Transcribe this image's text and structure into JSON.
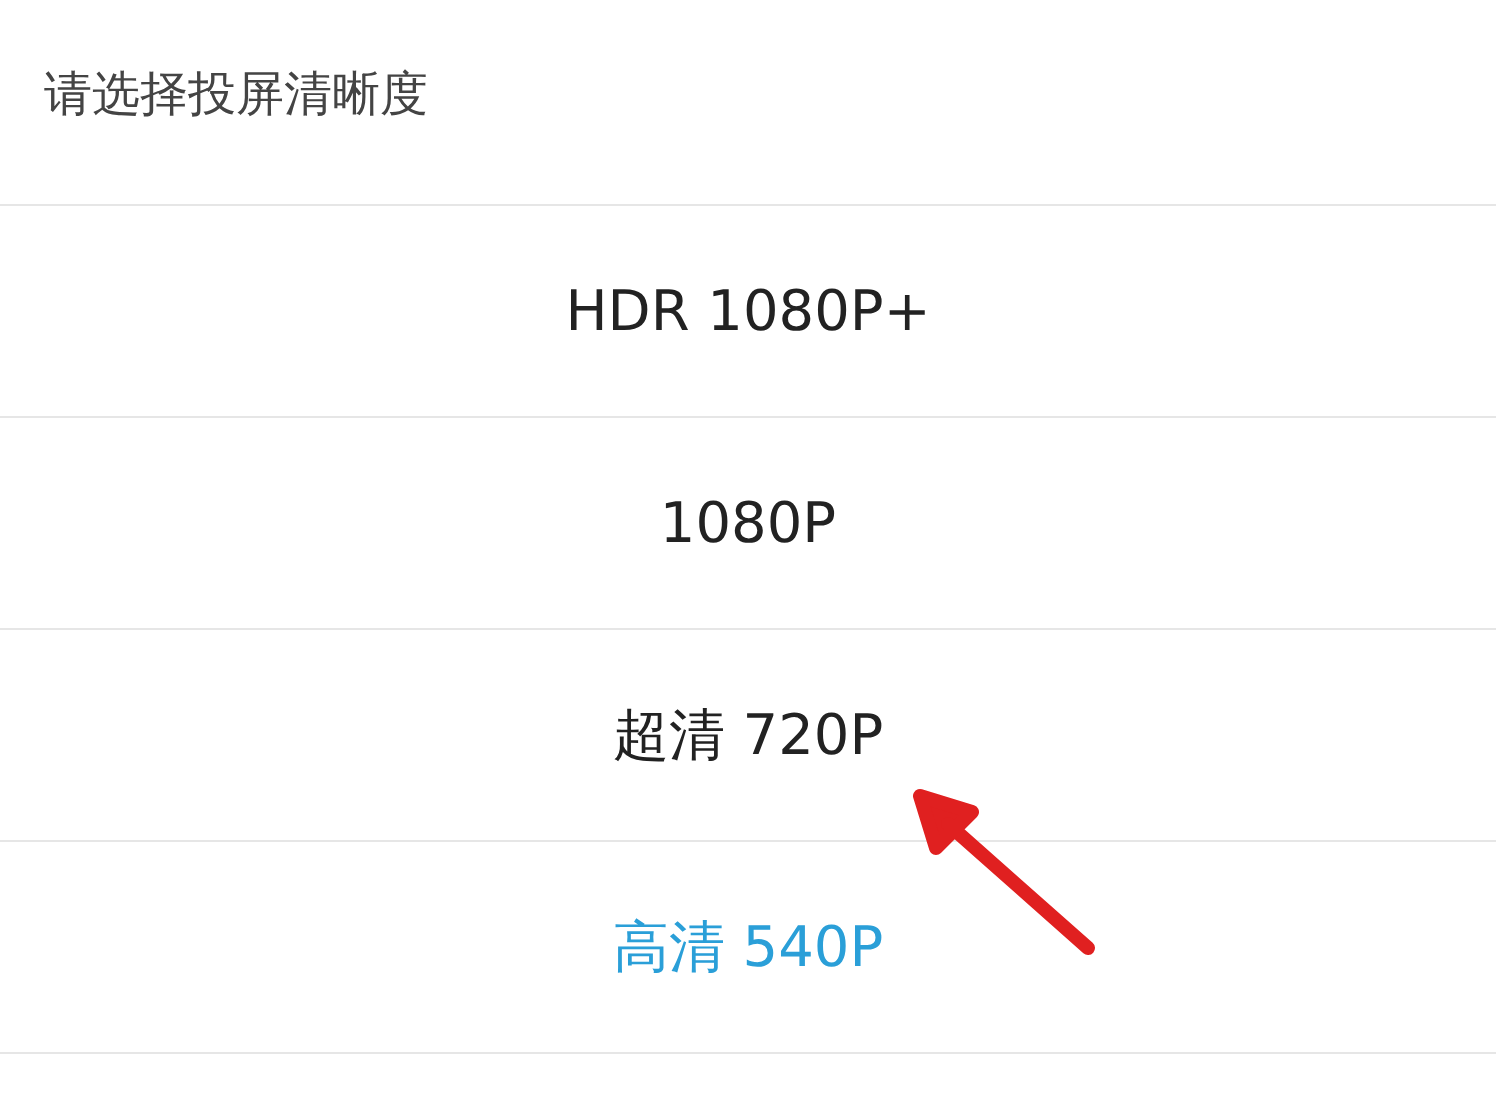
{
  "dialog": {
    "title": "请选择投屏清晰度",
    "options": [
      {
        "label": "HDR 1080P+",
        "selected": false
      },
      {
        "label": "1080P",
        "selected": false
      },
      {
        "label": "超清 720P",
        "selected": false
      },
      {
        "label": "高清 540P",
        "selected": true
      }
    ]
  }
}
